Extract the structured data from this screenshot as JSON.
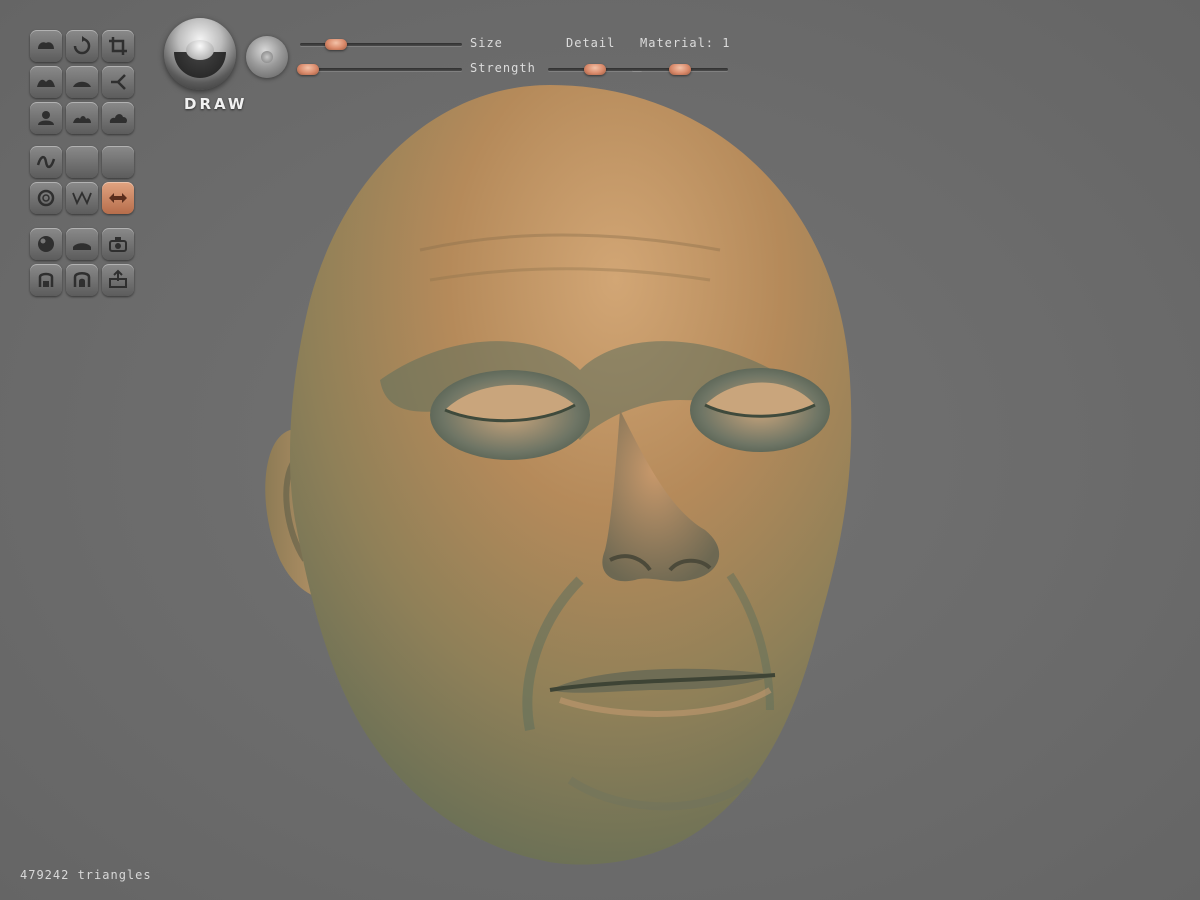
{
  "tool": {
    "name": "DRAW"
  },
  "params": {
    "size_label": "Size",
    "strength_label": "Strength",
    "detail_label": "Detail",
    "material_label": "Material: 1",
    "size_value": 0.22,
    "strength_value": 0.05,
    "detail_value": 0.5,
    "material_value": 0.5
  },
  "tools": {
    "group1": [
      "grab-icon",
      "rotate-icon",
      "crop-icon",
      "inflate-icon",
      "flatten-icon",
      "branch-icon",
      "layer-icon",
      "smooth-icon",
      "cloud-icon"
    ],
    "group2": [
      "curve-icon",
      "blank-icon",
      "blank-icon",
      "ring-icon",
      "wave-icon",
      "symmetry-icon"
    ],
    "group3": [
      "sphere-icon",
      "plane-icon",
      "camera-icon",
      "stamp-icon",
      "mask-icon",
      "export-icon"
    ],
    "active": "symmetry-icon",
    "accent": "#c97a56"
  },
  "status": {
    "triangles": "479242 triangles"
  },
  "colors": {
    "background": "#6d6d6d",
    "skin": "#b58a5a",
    "skin_shadow": "#5f6f5c"
  }
}
